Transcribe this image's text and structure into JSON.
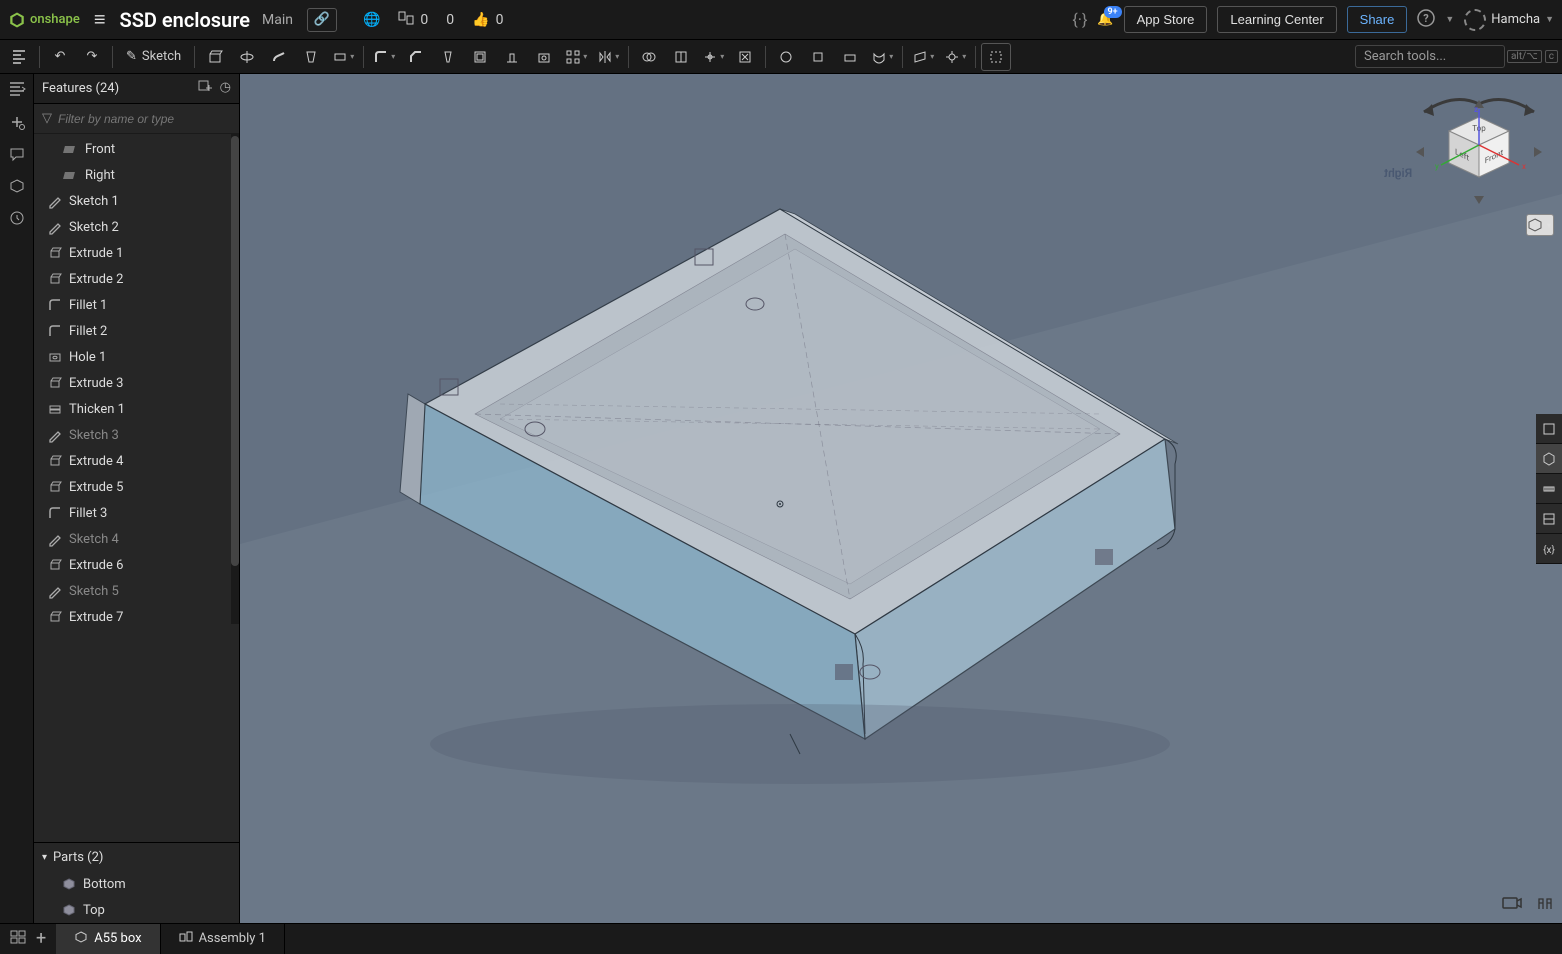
{
  "brand": "onshape",
  "document": {
    "title": "SSD enclosure",
    "subtitle": "Main"
  },
  "header": {
    "branch_count": "0",
    "comment_count": "0",
    "like_count": "0",
    "notifications_badge": "9+",
    "buttons": {
      "app_store": "App Store",
      "learning": "Learning Center",
      "share": "Share"
    },
    "user": "Hamcha"
  },
  "toolbar": {
    "sketch_label": "Sketch",
    "search_placeholder": "Search tools...",
    "shortcut_mod": "alt/⌥",
    "shortcut_key": "c"
  },
  "panel": {
    "features_title": "Features (24)",
    "filter_placeholder": "Filter by name or type",
    "items": [
      {
        "label": "Front",
        "icon": "plane",
        "indent": true
      },
      {
        "label": "Right",
        "icon": "plane",
        "indent": true
      },
      {
        "label": "Sketch 1",
        "icon": "pencil"
      },
      {
        "label": "Sketch 2",
        "icon": "pencil"
      },
      {
        "label": "Extrude 1",
        "icon": "extrude"
      },
      {
        "label": "Extrude 2",
        "icon": "extrude"
      },
      {
        "label": "Fillet 1",
        "icon": "fillet"
      },
      {
        "label": "Fillet 2",
        "icon": "fillet"
      },
      {
        "label": "Hole 1",
        "icon": "hole"
      },
      {
        "label": "Extrude 3",
        "icon": "extrude"
      },
      {
        "label": "Thicken 1",
        "icon": "thicken"
      },
      {
        "label": "Sketch 3",
        "icon": "pencil",
        "dim": true
      },
      {
        "label": "Extrude 4",
        "icon": "extrude"
      },
      {
        "label": "Extrude 5",
        "icon": "extrude"
      },
      {
        "label": "Fillet 3",
        "icon": "fillet"
      },
      {
        "label": "Sketch 4",
        "icon": "pencil",
        "dim": true
      },
      {
        "label": "Extrude 6",
        "icon": "extrude"
      },
      {
        "label": "Sketch 5",
        "icon": "pencil",
        "dim": true
      },
      {
        "label": "Extrude 7",
        "icon": "extrude"
      }
    ],
    "parts_title": "Parts (2)",
    "parts": [
      {
        "label": "Bottom"
      },
      {
        "label": "Top"
      }
    ]
  },
  "tabs": [
    {
      "label": "A55 box",
      "icon": "part",
      "active": true
    },
    {
      "label": "Assembly 1",
      "icon": "assembly",
      "active": false
    }
  ],
  "viewcube": {
    "top": "Top",
    "left": "Left",
    "front": "Front",
    "axis_x": "x",
    "axis_y": "y",
    "axis_z": "z"
  },
  "viewport": {
    "side_label": "Right"
  },
  "icons": {
    "hamburger": "≡",
    "link": "🔗",
    "globe": "🌐",
    "branch": "⎇",
    "comment": "💬",
    "like": "👍",
    "curly": "{·}",
    "bell": "🔔",
    "help": "?",
    "undo": "↶",
    "redo": "↷",
    "pencil": "✎",
    "filter": "▽",
    "add_feature": "⊞",
    "timer": "◷",
    "part": "▫",
    "assembly": "▧",
    "collapse": "☰",
    "gear": "⚙",
    "home": "⌂",
    "caret": "▾",
    "plus": "+"
  }
}
